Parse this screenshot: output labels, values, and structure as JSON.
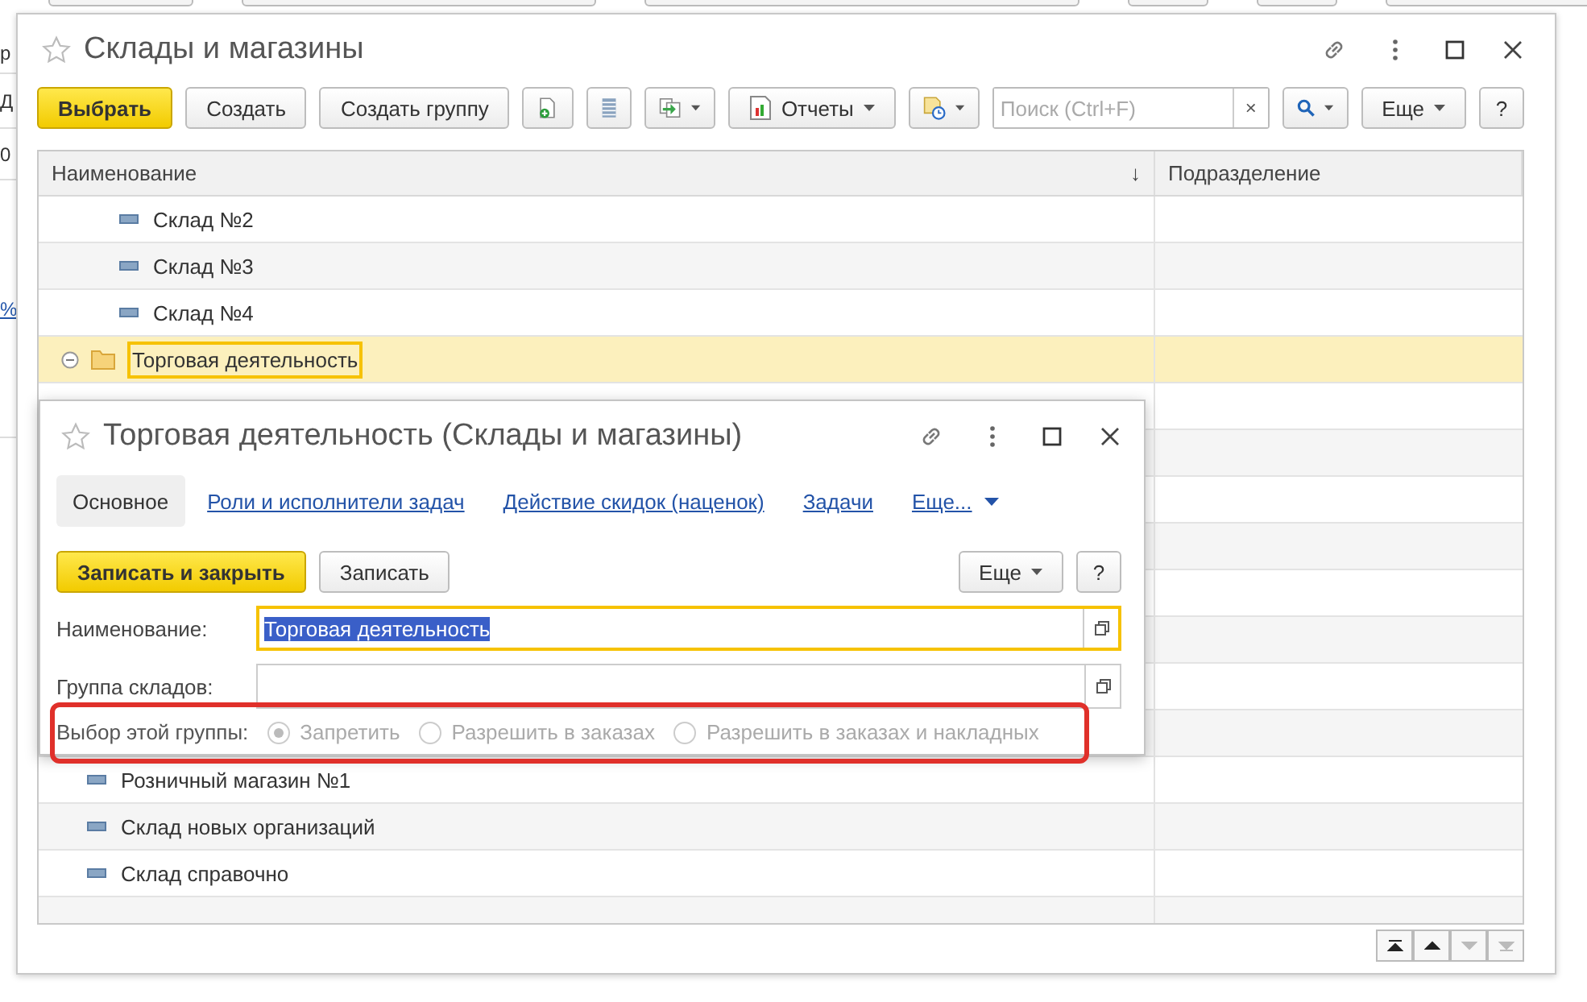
{
  "background": {
    "fragments": [
      {
        "text": "р",
        "kind": "plain"
      },
      {
        "text": "Д",
        "kind": "plain"
      },
      {
        "text": "0",
        "kind": "plain"
      },
      {
        "text": "%",
        "kind": "link"
      }
    ]
  },
  "window": {
    "title": "Склады и магазины"
  },
  "toolbar": [
    {
      "kind": "primary",
      "label": "Выбрать"
    },
    {
      "kind": "button",
      "label": "Создать"
    },
    {
      "kind": "button",
      "label": "Создать группу"
    },
    {
      "kind": "icon"
    },
    {
      "kind": "icon"
    },
    {
      "kind": "icon-menu"
    },
    {
      "kind": "menu",
      "label": "Отчеты"
    },
    {
      "kind": "icon-menu"
    },
    {
      "kind": "search",
      "placeholder": "Поиск (Ctrl+F)",
      "clear": "×"
    },
    {
      "kind": "icon-menu"
    },
    {
      "kind": "menu",
      "label": "Еще"
    },
    {
      "kind": "button",
      "label": "?"
    }
  ],
  "table": {
    "columns": [
      {
        "label": "Наименование",
        "sort": "↓"
      },
      {
        "label": "Подразделение"
      }
    ],
    "rows": [
      {
        "kind": "continuation",
        "children": [
          {
            "kind": "item",
            "name": "Склад №2",
            "selected": false
          },
          {
            "kind": "item",
            "name": "Склад №3",
            "selected": false
          },
          {
            "kind": "item",
            "name": "Склад №4",
            "selected": false
          }
        ]
      },
      {
        "kind": "group",
        "name": "Торговая деятельность",
        "selected": true,
        "expanded": true
      },
      {
        "kind": "item",
        "name": "Розничный магазин №1",
        "selected": false
      },
      {
        "kind": "item",
        "name": "Склад новых организаций",
        "selected": false
      },
      {
        "kind": "item",
        "name": "Склад справочно",
        "selected": false
      }
    ]
  },
  "dialog": {
    "title": "Торговая деятельность (Склады и магазины)",
    "tabs": [
      {
        "label": "Основное",
        "selected": true,
        "kind": "tab"
      },
      {
        "label": "Роли и исполнители задач",
        "selected": false,
        "kind": "tab"
      },
      {
        "label": "Действие скидок (наценок)",
        "selected": false,
        "kind": "tab"
      },
      {
        "label": "Задачи",
        "selected": false,
        "kind": "tab"
      },
      {
        "label": "Еще...",
        "selected": false,
        "kind": "menu"
      }
    ],
    "buttons": [
      {
        "kind": "primary",
        "label": "Записать и закрыть"
      },
      {
        "kind": "button",
        "label": "Записать"
      }
    ],
    "right_buttons": [
      {
        "kind": "menu",
        "label": "Еще"
      },
      {
        "kind": "button",
        "label": "?"
      }
    ],
    "fields": [
      {
        "label": "Наименование:",
        "value": "Торговая деятельность",
        "focused": true
      },
      {
        "label": "Группа складов:",
        "focused": false
      }
    ],
    "choice": {
      "label": "Выбор этой группы:",
      "highlighted": true,
      "options": [
        {
          "label": "Запретить",
          "selected": true,
          "disabled": true
        },
        {
          "label": "Разрешить в заказах",
          "selected": false,
          "disabled": true
        },
        {
          "label": "Разрешить в заказах и накладных",
          "selected": false,
          "disabled": true
        }
      ]
    }
  }
}
